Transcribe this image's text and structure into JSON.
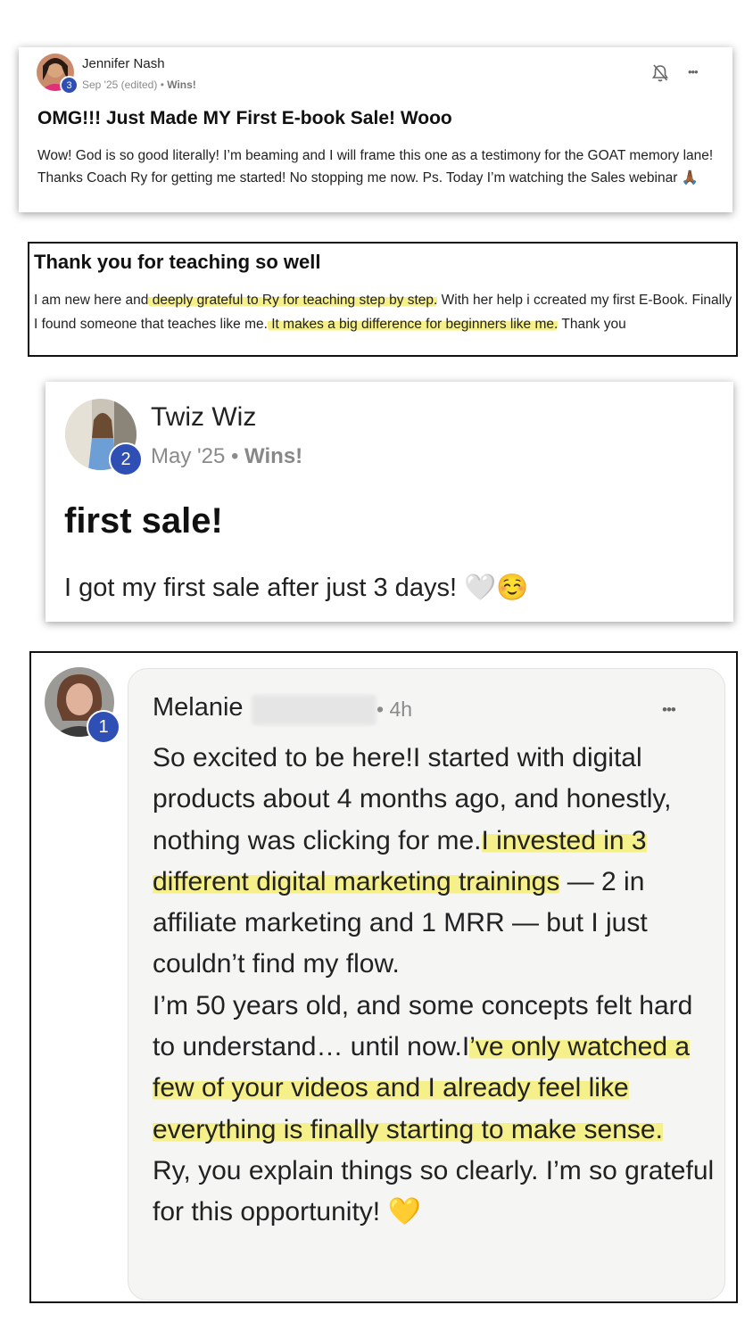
{
  "post1": {
    "author": "Jennifer Nash",
    "badge": "3",
    "date": "Sep '25 (edited)",
    "separator": "•",
    "category": "Wins!",
    "title": "OMG!!! Just Made MY First E-book Sale! Wooo",
    "body": "Wow! God is so good literally! I’m beaming and I will frame this one as a testimony for the GOAT memory lane! Thanks Coach Ry for getting me started! No stopping me now. Ps. Today I’m watching the Sales webinar 🙏🏾",
    "bell_icon": "bell-off-icon",
    "more_icon": "more-icon",
    "more_glyph": "•••"
  },
  "post2": {
    "title": "Thank you for teaching so well",
    "body_a": "I am new here and",
    "body_hl1": " deeply grateful to Ry for teaching step by step.",
    "body_b": " With her help i ccreated my first E-Book. Finally I found someone that teaches like me.",
    "body_hl2": " It makes a big difference for beginners like me.",
    "body_c": " Thank you"
  },
  "post3": {
    "author": "Twiz Wiz",
    "badge": "2",
    "date": "May '25",
    "separator": "•",
    "category": "Wins!",
    "title": "first sale!",
    "body": "I got my first sale after just 3 days! 🤍☺️"
  },
  "post4": {
    "author": "Melanie",
    "time": "• 4h",
    "badge": "1",
    "more_glyph": "•••",
    "line1": "So excited to be here!I started with digital products about 4 months ago, and honestly, nothing was clicking for me.",
    "hl1": "I invested in 3 different digital marketing trainings",
    "line2": " — 2 in affiliate marketing and 1 MRR — but I just couldn’t find my flow.",
    "line3": "I’m 50 years old, and some concepts felt hard to understand… until now.I",
    "hl2": "’ve only watched a few of your videos and I already feel like everything is finally starting to make sense.",
    "line4": "Ry, you explain things so clearly. I’m so grateful for this opportunity! 💛"
  },
  "colors": {
    "badge": "#2f4fb4",
    "highlight": "#f6f08a",
    "bubble": "#f5f5f4"
  }
}
